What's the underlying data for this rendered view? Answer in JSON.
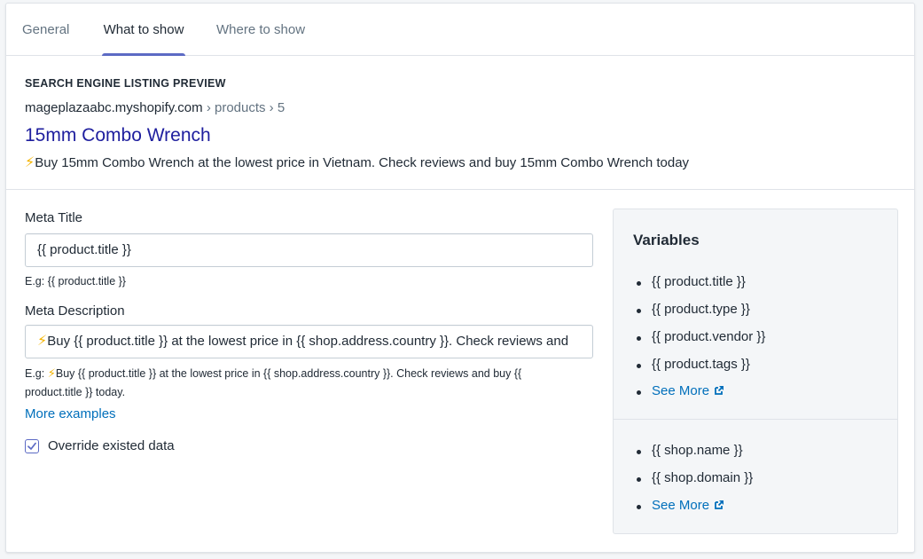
{
  "tabs": [
    {
      "label": "General"
    },
    {
      "label": "What to show"
    },
    {
      "label": "Where to show"
    }
  ],
  "preview": {
    "heading": "SEARCH ENGINE LISTING PREVIEW",
    "domain": "mageplazaabc.myshopify.com",
    "crumbs": " › products › 5",
    "title": "15mm Combo Wrench",
    "description": "Buy 15mm Combo Wrench at the lowest price in Vietnam. Check reviews and buy 15mm Combo Wrench today",
    "bolt_icon": "⚡"
  },
  "form": {
    "meta_title_label": "Meta Title",
    "meta_title_value": "{{ product.title }}",
    "meta_title_example": "E.g: {{ product.title }}",
    "meta_desc_label": "Meta Description",
    "meta_desc_value": "Buy {{ product.title }} at the lowest price in {{ shop.address.country }}. Check reviews and",
    "meta_desc_example_prefix": "E.g: ",
    "meta_desc_example_line1": "Buy {{ product.title }} at the lowest price in {{ shop.address.country }}. Check reviews and buy {{",
    "meta_desc_example_line2": "product.title }} today.",
    "more_examples": "More examples",
    "override_label": "Override existed data",
    "override_checked": true
  },
  "variables": {
    "title": "Variables",
    "product_items": [
      "{{ product.title }}",
      "{{ product.type }}",
      "{{ product.vendor }}",
      "{{ product.tags }}"
    ],
    "shop_items": [
      "{{ shop.name }}",
      "{{ shop.domain }}"
    ],
    "see_more": "See More"
  },
  "colors": {
    "accent": "#5c6ac4",
    "link": "#006fbb",
    "preview_title": "#1e1e9e",
    "bolt": "#f4b400"
  }
}
